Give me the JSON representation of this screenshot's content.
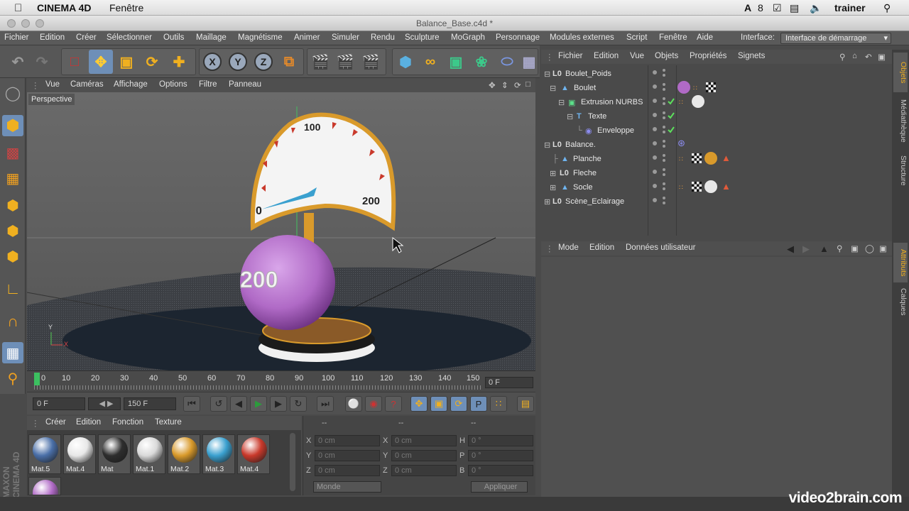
{
  "mac_menu": {
    "app": "CINEMA 4D",
    "window_menu": "Fenêtre",
    "badge": "8",
    "user": "trainer"
  },
  "window": {
    "title": "Balance_Base.c4d *"
  },
  "main_menu": [
    "Fichier",
    "Edition",
    "Créer",
    "Sélectionner",
    "Outils",
    "Maillage",
    "Magnétisme",
    "Animer",
    "Simuler",
    "Rendu",
    "Sculpture",
    "MoGraph",
    "Personnage",
    "Modules externes",
    "Script",
    "Fenêtre",
    "Aide"
  ],
  "interface": {
    "label": "Interface:",
    "value": "Interface de démarrage"
  },
  "viewport": {
    "menu": [
      "Vue",
      "Caméras",
      "Affichage",
      "Options",
      "Filtre",
      "Panneau"
    ],
    "label": "Perspective",
    "axis_y": "Y",
    "axis_x": "X",
    "dial_labels": [
      "0",
      "100",
      "200"
    ],
    "ball_text": "200"
  },
  "timeline": {
    "ticks": [
      "0",
      "10",
      "20",
      "30",
      "40",
      "50",
      "60",
      "70",
      "80",
      "90",
      "100",
      "110",
      "120",
      "130",
      "140",
      "150"
    ],
    "current": "0 F"
  },
  "transport": {
    "start": "0 F",
    "end": "150 F"
  },
  "materials": {
    "menu": [
      "Créer",
      "Edition",
      "Fonction",
      "Texture"
    ],
    "items": [
      {
        "name": "Mat.5",
        "color": "#4a6fa8"
      },
      {
        "name": "Mat.4",
        "color": "#e8e8e8"
      },
      {
        "name": "Mat",
        "color": "#2e2e2e"
      },
      {
        "name": "Mat.1",
        "color": "#d9d9d9"
      },
      {
        "name": "Mat.2",
        "color": "#d99a2b"
      },
      {
        "name": "Mat.3",
        "color": "#3aa0cf"
      },
      {
        "name": "Mat.4",
        "color": "#c9392b"
      }
    ],
    "extra_color": "#b06ac6"
  },
  "coords": {
    "headers": [
      "--",
      "--",
      "--"
    ],
    "rows": [
      {
        "l1": "X",
        "v1": "0 cm",
        "l2": "X",
        "v2": "0 cm",
        "l3": "H",
        "v3": "0 °"
      },
      {
        "l1": "Y",
        "v1": "0 cm",
        "l2": "Y",
        "v2": "0 cm",
        "l3": "P",
        "v3": "0 °"
      },
      {
        "l1": "Z",
        "v1": "0 cm",
        "l2": "Z",
        "v2": "0 cm",
        "l3": "B",
        "v3": "0 °"
      }
    ],
    "mode": "Monde",
    "apply": "Appliquer"
  },
  "objects": {
    "menu": [
      "Fichier",
      "Edition",
      "Vue",
      "Objets",
      "Propriétés",
      "Signets"
    ],
    "rows": [
      {
        "label": "Boulet_Poids"
      },
      {
        "label": "Boulet"
      },
      {
        "label": "Extrusion NURBS"
      },
      {
        "label": "Texte"
      },
      {
        "label": "Enveloppe"
      },
      {
        "label": "Balance."
      },
      {
        "label": "Planche"
      },
      {
        "label": "Fleche"
      },
      {
        "label": "Socle"
      },
      {
        "label": "Scène_Eclairage"
      }
    ]
  },
  "attributes": {
    "menu": [
      "Mode",
      "Edition",
      "Données utilisateur"
    ]
  },
  "side_tabs": [
    "Objets",
    "Médiathèque",
    "Structure",
    "Attributs",
    "Calques"
  ],
  "brand": {
    "maxon": "MAXON CINEMA 4D",
    "watermark": "video2brain.com"
  },
  "colors": {
    "accent": "#6e8fb8",
    "dial_orange": "#d99a2b",
    "ball_purple": "#b06ac6",
    "needle_blue": "#3aa0cf"
  }
}
